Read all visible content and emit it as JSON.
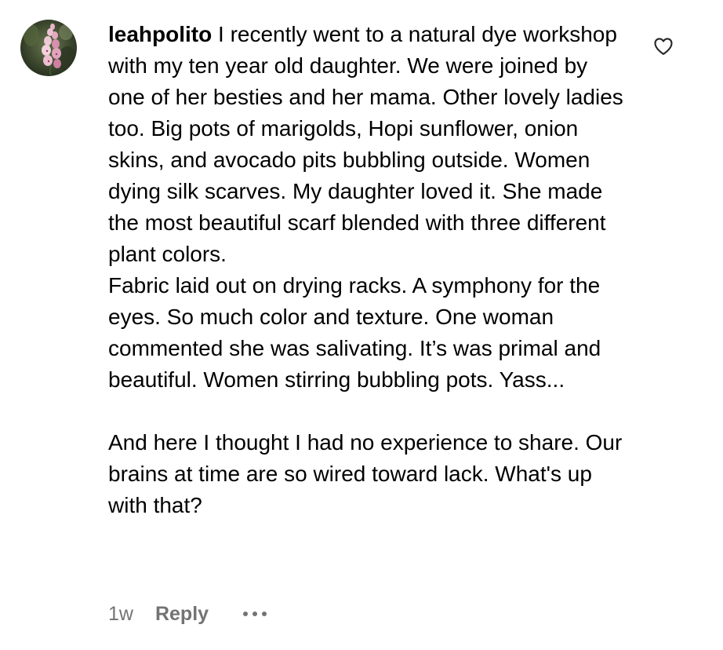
{
  "comment": {
    "username": "leahpolito",
    "paragraph_1": "I recently went to a natural dye workshop with my ten year old daughter. We were joined by one of her besties and her mama. Other lovely ladies too. Big pots of marigolds, Hopi sunflower, onion skins, and avocado pits bubbling outside. Women dying silk scarves. My daughter loved it. She made the most beautiful scarf blended with three different plant colors.",
    "paragraph_2": "Fabric laid out on drying racks. A symphony for the eyes. So much color and texture. One woman commented she was salivating. It’s was primal and beautiful. Women stirring bubbling pots. Yass...",
    "paragraph_3": "And here I thought I had no experience to share. Our brains at time are so wired toward lack. What's up with that?",
    "timestamp": "1w",
    "reply_label": "Reply",
    "more_icon": "more-horizontal-icon",
    "like_icon": "heart-outline-icon",
    "avatar_icon": "avatar-foxglove-photo"
  },
  "colors": {
    "text": "#000000",
    "meta": "#737373",
    "background": "#ffffff"
  }
}
